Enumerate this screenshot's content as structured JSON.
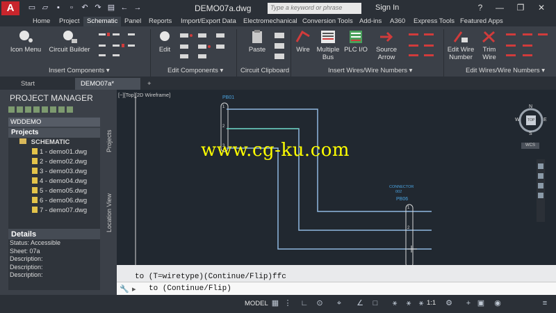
{
  "titlebar": {
    "document": "DEMO07a.dwg",
    "search_placeholder": "Type a keyword or phrase",
    "sign_in": "Sign In",
    "help": "?"
  },
  "menu_tabs": [
    "Home",
    "Project",
    "Schematic",
    "Panel",
    "Reports",
    "Import/Export Data",
    "Electromechanical",
    "Conversion Tools",
    "Add-ins",
    "A360",
    "Express Tools",
    "Featured Apps"
  ],
  "ribbon": {
    "buttons": [
      "Icon Menu",
      "Circuit Builder",
      "Edit",
      "Paste",
      "Wire",
      "Multiple",
      "Bus",
      "PLC I/O",
      "Source",
      "Arrow",
      "Edit Wire",
      "Number",
      "Trim",
      "Wire"
    ],
    "panels": [
      "Insert Components ▾",
      "Edit Components ▾",
      "Circuit Clipboard",
      "Insert Wires/Wire Numbers ▾",
      "Edit Wires/Wire Numbers ▾"
    ]
  },
  "doc_tabs": [
    "Start",
    "DEMO07a*",
    "+"
  ],
  "project_manager": {
    "title": "PROJECT MANAGER",
    "project_select": "WDDEMO",
    "tree_header": "Projects",
    "folder": "SCHEMATIC",
    "files": [
      "1 - demo01.dwg",
      "2 - demo02.dwg",
      "3 - demo03.dwg",
      "4 - demo04.dwg",
      "5 - demo05.dwg",
      "6 - demo06.dwg",
      "7 - demo07.dwg"
    ],
    "side_tabs": [
      "Projects",
      "Location View"
    ]
  },
  "details": {
    "title": "Details",
    "rows": [
      "Status: Accessible",
      "Sheet: 07a",
      "Description:",
      "Description:",
      "Description:"
    ]
  },
  "canvas": {
    "viewport_label": "[−][Top][2D Wireframe]",
    "tag_left": "PB01",
    "tag_right": "PB06",
    "connector_label": "CONNECTOR",
    "connector_num": "002",
    "pin_labels": [
      "1",
      "2",
      "3"
    ],
    "viewcube_top": "TOP",
    "compass": [
      "N",
      "W",
      "E",
      "S"
    ],
    "wcs": "WCS"
  },
  "command": {
    "history": "to  (T=wiretype)(Continue/Flip)ffc",
    "input": "to (Continue/Flip)"
  },
  "statusbar": {
    "model": "MODEL",
    "scale": "1:1"
  },
  "watermark": "www.cg-ku.com"
}
